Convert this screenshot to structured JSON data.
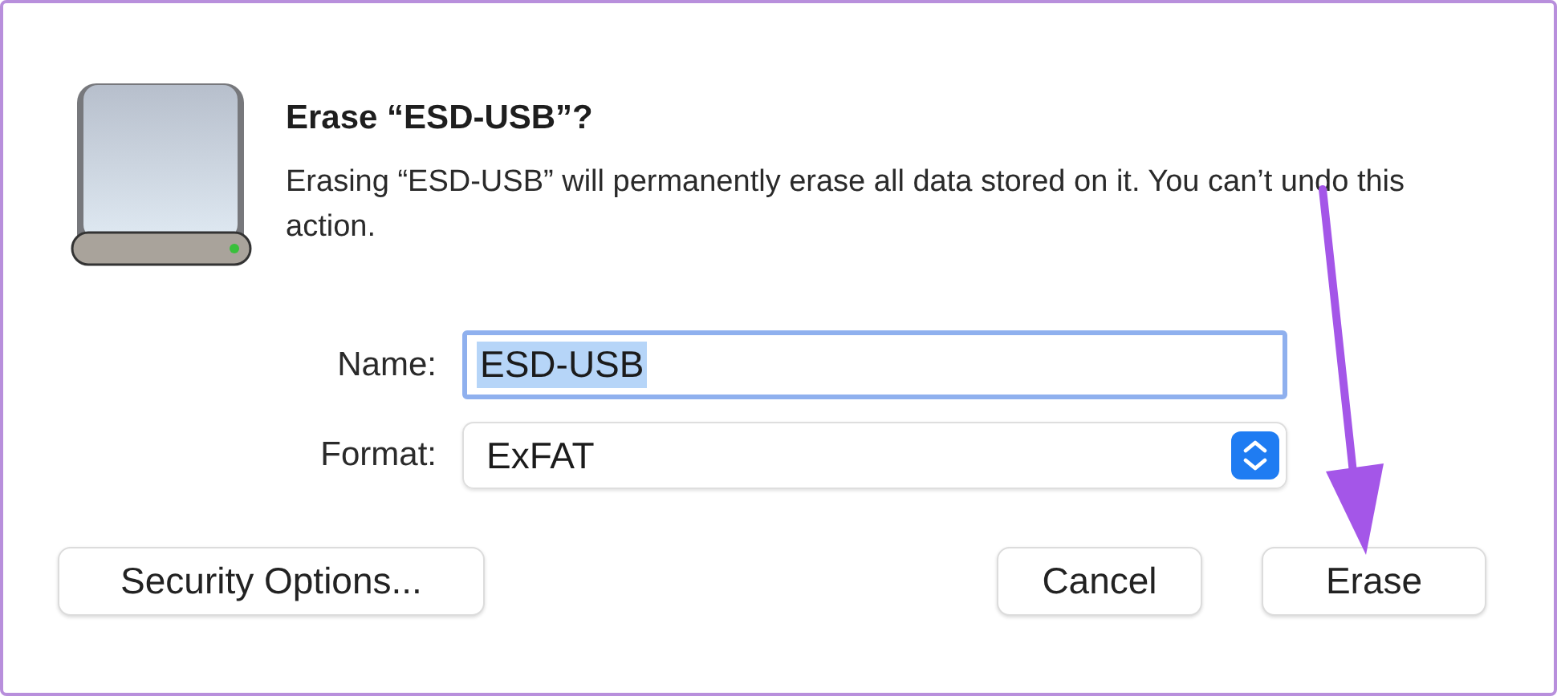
{
  "dialog": {
    "title": "Erase “ESD-USB”?",
    "message": "Erasing “ESD-USB” will permanently erase all data stored on it. You can’t undo this action."
  },
  "form": {
    "name": {
      "label": "Name:",
      "value": "ESD-USB",
      "focused": true,
      "text_selected": true
    },
    "format": {
      "label": "Format:",
      "value": "ExFAT"
    }
  },
  "buttons": [
    {
      "label": "Security Options...",
      "kind": "left"
    },
    {
      "label": "Cancel",
      "kind": "right"
    },
    {
      "label": "Erase",
      "kind": "right"
    }
  ]
}
